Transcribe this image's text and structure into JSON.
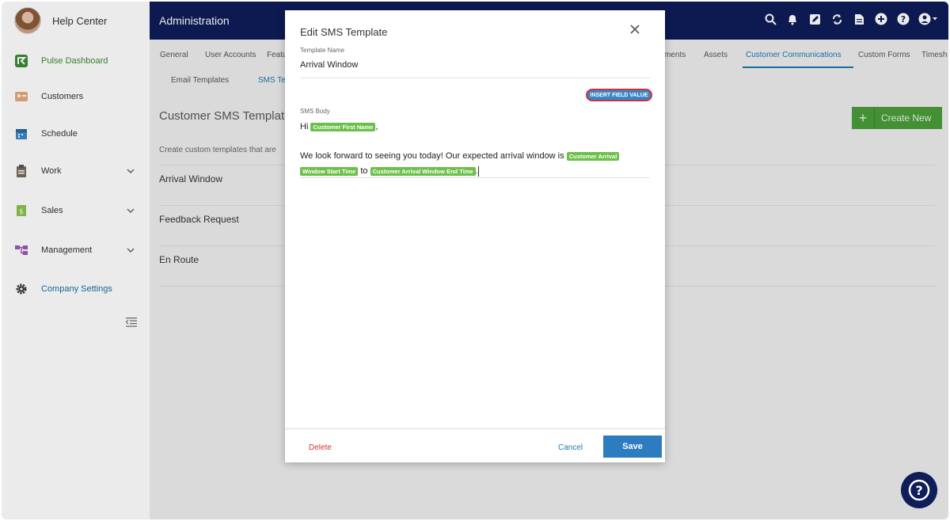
{
  "sidebar": {
    "help_label": "Help Center",
    "items": [
      {
        "label": "Pulse Dashboard",
        "color": "#3a8a32",
        "icon": "pulse-logo-icon"
      },
      {
        "label": "Customers",
        "color": "#333333",
        "icon": "customers-icon"
      },
      {
        "label": "Schedule",
        "color": "#333333",
        "icon": "calendar-icon"
      },
      {
        "label": "Work",
        "color": "#333333",
        "icon": "clipboard-icon"
      },
      {
        "label": "Sales",
        "color": "#333333",
        "icon": "sales-icon"
      },
      {
        "label": "Management",
        "color": "#333333",
        "icon": "management-icon"
      },
      {
        "label": "Company Settings",
        "color": "#1a6fa8",
        "icon": "gear-icon"
      }
    ]
  },
  "header": {
    "title": "Administration",
    "icons": [
      "search-icon",
      "bell-icon",
      "edit-icon",
      "sync-icon",
      "document-icon",
      "add-icon",
      "help-icon",
      "user-icon"
    ]
  },
  "tabs": {
    "primary": [
      "General",
      "User Accounts",
      "Featu",
      "ments",
      "Assets",
      "Customer Communications",
      "Custom Forms",
      "Timesh"
    ],
    "secondary": [
      "Email Templates",
      "SMS Te"
    ]
  },
  "content": {
    "title": "Customer SMS Template",
    "description": "Create custom templates that are",
    "rows": [
      "Arrival Window",
      "Feedback Request",
      "En Route"
    ],
    "create_label": "Create New",
    "create_plus": "+"
  },
  "modal": {
    "title": "Edit SMS Template",
    "template_name_label": "Template Name",
    "template_name_value": "Arrival Window",
    "insert_field_label": "INSERT FIELD VALUE",
    "sms_body_label": "SMS Body",
    "body_hi": "Hi",
    "chip_first_name": "Customer First Name",
    "comma": ",",
    "body_sentence": "We look forward to seeing you today! Our expected arrival window is",
    "chip_start_a": "Customer Arrival",
    "chip_start_b": "Window Start Time",
    "body_to": "to",
    "chip_end": "Customer Arrival Window End Time",
    "period": ".",
    "delete_label": "Delete",
    "cancel_label": "Cancel",
    "save_label": "Save"
  },
  "help_fab": "?"
}
